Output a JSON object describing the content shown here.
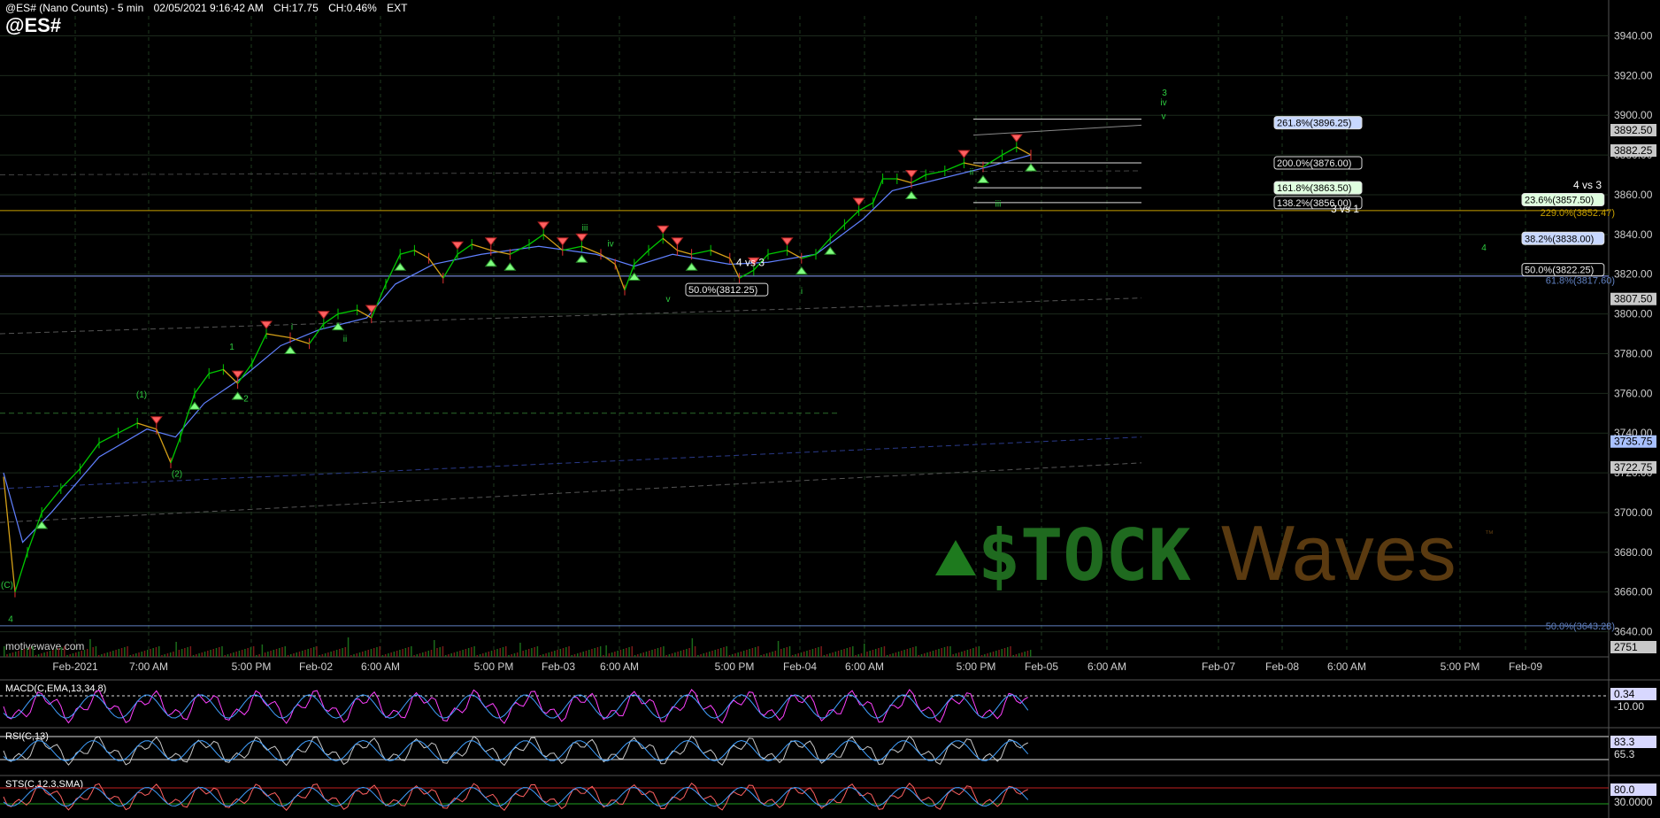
{
  "header": {
    "title": "@ES# (Nano Counts) - 5 min",
    "datetime": "02/05/2021 9:16:42 AM",
    "change": "CH:17.75",
    "change_pct": "CH:0.46%",
    "session": "EXT",
    "symbol": "@ES#"
  },
  "watermark": {
    "left": "motivewave.com",
    "brand_stock": "$TOCK",
    "brand_waves": "Waves",
    "tm": "™"
  },
  "colors": {
    "background": "#000000",
    "up": "#00c800",
    "down": "#e03030",
    "ma": "#6080ff",
    "grid": "#1a3a1a",
    "wave_label": "#2ecc40"
  },
  "chart_data": {
    "type": "line",
    "title": "@ES# (Nano Counts) - 5 min",
    "ylim": [
      3630,
      3950
    ],
    "price_ticks": [
      3940,
      3920,
      3900,
      3880,
      3860,
      3840,
      3820,
      3800,
      3780,
      3760,
      3740,
      3720,
      3700,
      3680,
      3660,
      3640
    ],
    "price_labels": [
      "3940.00",
      "3920.00",
      "3900.00",
      "3880.00",
      "3860.00",
      "3840.00",
      "3820.00",
      "3800.00",
      "3780.00",
      "3760.00",
      "3740.00",
      "3720.00",
      "3700.00",
      "3680.00",
      "3660.00",
      "3640.00"
    ],
    "time_labels": [
      "Feb-2021",
      "7:00 AM",
      "5:00 PM",
      "Feb-02",
      "6:00 AM",
      "5:00 PM",
      "Feb-03",
      "6:00 AM",
      "5:00 PM",
      "Feb-04",
      "6:00 AM",
      "5:00 PM",
      "Feb-05",
      "6:00 AM",
      "Feb-07",
      "Feb-08",
      "6:00 AM",
      "5:00 PM",
      "Feb-09"
    ],
    "price_series": [
      [
        0,
        3718
      ],
      [
        12,
        3660
      ],
      [
        25,
        3680
      ],
      [
        40,
        3700
      ],
      [
        60,
        3712
      ],
      [
        80,
        3722
      ],
      [
        100,
        3735
      ],
      [
        120,
        3740
      ],
      [
        140,
        3745
      ],
      [
        160,
        3742
      ],
      [
        175,
        3725
      ],
      [
        185,
        3738
      ],
      [
        200,
        3760
      ],
      [
        215,
        3770
      ],
      [
        230,
        3772
      ],
      [
        245,
        3765
      ],
      [
        260,
        3775
      ],
      [
        275,
        3790
      ],
      [
        300,
        3788
      ],
      [
        320,
        3785
      ],
      [
        335,
        3795
      ],
      [
        350,
        3800
      ],
      [
        370,
        3802
      ],
      [
        385,
        3798
      ],
      [
        400,
        3815
      ],
      [
        415,
        3830
      ],
      [
        430,
        3832
      ],
      [
        445,
        3828
      ],
      [
        460,
        3818
      ],
      [
        475,
        3830
      ],
      [
        490,
        3835
      ],
      [
        510,
        3832
      ],
      [
        530,
        3830
      ],
      [
        550,
        3835
      ],
      [
        565,
        3840
      ],
      [
        585,
        3832
      ],
      [
        605,
        3834
      ],
      [
        625,
        3830
      ],
      [
        640,
        3825
      ],
      [
        650,
        3812
      ],
      [
        660,
        3825
      ],
      [
        675,
        3832
      ],
      [
        690,
        3838
      ],
      [
        705,
        3832
      ],
      [
        720,
        3830
      ],
      [
        740,
        3832
      ],
      [
        760,
        3828
      ],
      [
        770,
        3818
      ],
      [
        785,
        3822
      ],
      [
        800,
        3830
      ],
      [
        820,
        3832
      ],
      [
        835,
        3828
      ],
      [
        850,
        3830
      ],
      [
        865,
        3838
      ],
      [
        880,
        3845
      ],
      [
        895,
        3852
      ],
      [
        910,
        3856
      ],
      [
        920,
        3868
      ],
      [
        935,
        3868
      ],
      [
        950,
        3866
      ],
      [
        965,
        3870
      ],
      [
        985,
        3872
      ],
      [
        1005,
        3876
      ],
      [
        1025,
        3874
      ],
      [
        1045,
        3880
      ],
      [
        1060,
        3884
      ],
      [
        1075,
        3880
      ]
    ],
    "ma_series": [
      [
        0,
        3720
      ],
      [
        20,
        3685
      ],
      [
        50,
        3700
      ],
      [
        100,
        3728
      ],
      [
        150,
        3742
      ],
      [
        180,
        3738
      ],
      [
        210,
        3755
      ],
      [
        250,
        3768
      ],
      [
        290,
        3784
      ],
      [
        330,
        3792
      ],
      [
        380,
        3798
      ],
      [
        410,
        3815
      ],
      [
        450,
        3825
      ],
      [
        500,
        3830
      ],
      [
        560,
        3834
      ],
      [
        620,
        3830
      ],
      [
        660,
        3824
      ],
      [
        700,
        3830
      ],
      [
        760,
        3825
      ],
      [
        800,
        3826
      ],
      [
        850,
        3830
      ],
      [
        900,
        3848
      ],
      [
        930,
        3862
      ],
      [
        980,
        3868
      ],
      [
        1030,
        3874
      ],
      [
        1075,
        3880
      ]
    ],
    "price_boxes": [
      {
        "label": "3892.50",
        "value": 3892.5,
        "color": "#c8c8c8"
      },
      {
        "label": "3882.25",
        "value": 3882.25,
        "color": "#c8c8c8"
      },
      {
        "label": "3807.50",
        "value": 3807.5,
        "color": "#c8c8c8"
      },
      {
        "label": "3735.75",
        "value": 3735.75,
        "color": "#a8c0ff"
      },
      {
        "label": "3722.75",
        "value": 3722.75,
        "color": "#c8c8c8"
      },
      {
        "label": "2751",
        "value": 3636,
        "color": "#c8c8c8"
      }
    ],
    "fib_levels": [
      {
        "label": "261.8%(3896.25)",
        "value": 3896.25,
        "bg": "#c8d8ff"
      },
      {
        "label": "200.0%(3876.00)",
        "value": 3876.0,
        "bg": "#000000"
      },
      {
        "label": "161.8%(3863.50)",
        "value": 3863.5,
        "bg": "#e0ffe0"
      },
      {
        "label": "138.2%(3856.00)",
        "value": 3856.0,
        "bg": "#000000"
      },
      {
        "label": "23.6%(3857.50)",
        "value": 3857.5,
        "bg": "#e0ffe0"
      },
      {
        "label": "38.2%(3838.00)",
        "value": 3838.0,
        "bg": "#c8d8ff"
      },
      {
        "label": "50.0%(3822.25)",
        "value": 3822.25,
        "bg": "#000000"
      },
      {
        "label": "50.0%(3812.25)",
        "value": 3812.25,
        "bg": "#000000"
      }
    ],
    "faint_labels": [
      "229.0%(3852.47)",
      "61.8%(3817.60)",
      "50.0%(3643.28)"
    ],
    "notes": [
      "4 vs 3",
      "3 vs 1",
      "4 vs 3"
    ],
    "wave_labels": [
      "(C)",
      "4",
      "(1)",
      "(2)",
      "1",
      "2",
      "i",
      "ii",
      "iii",
      "iv",
      "v",
      "i",
      "ii",
      "iii",
      "iv",
      "v",
      "3",
      "4"
    ],
    "macd": {
      "label": "MACD(C,EMA,13,34,8)",
      "values": [
        "0.34",
        "-10.00"
      ]
    },
    "rsi": {
      "label": "RSI(C,13)",
      "values": [
        "83.3",
        "65.3"
      ]
    },
    "stoch": {
      "label": "STS(C,12,3,SMA)",
      "values": [
        "80.0",
        "30.0000"
      ]
    }
  }
}
